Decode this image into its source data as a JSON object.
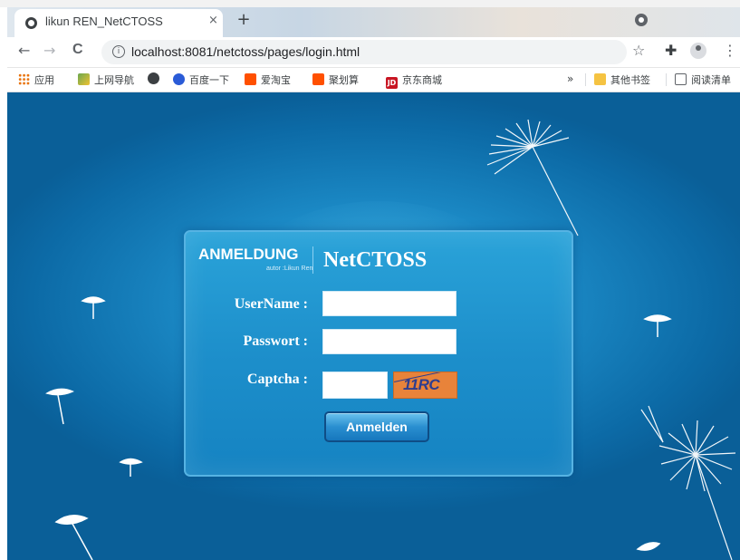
{
  "browser": {
    "tab_title": "likun REN_NetCTOSS",
    "tab_close": "×",
    "new_tab": "+",
    "url": "localhost:8081/netctoss/pages/login.html",
    "info_icon": "i",
    "nav": {
      "back": "←",
      "forward": "→",
      "reload": "C"
    },
    "star": "☆",
    "extensions": "✚",
    "menu": "⋮"
  },
  "bookmarks": {
    "apps": "应用",
    "items": [
      "上网导航",
      "",
      "百度一下",
      "爱淘宝",
      "聚划算",
      "京东商城"
    ],
    "overflow": "»",
    "other": "其他书签",
    "reading_list": "阅读清单",
    "jd_badge": "JD"
  },
  "login": {
    "brand": "ANMELDUNG",
    "author": "autor :Likun Ren",
    "app_name": "NetCTOSS",
    "username_label": "UserName :",
    "username_value": "",
    "password_label": "Passwort :",
    "password_value": "",
    "captcha_label": "Captcha :",
    "captcha_value": "",
    "captcha_image_text": "11RC",
    "submit": "Anmelden"
  },
  "colors": {
    "background": "#1b89c5",
    "panel_border": "#56b3e3",
    "captcha_bg": "#e8833a",
    "button": "#2a8fd0"
  }
}
